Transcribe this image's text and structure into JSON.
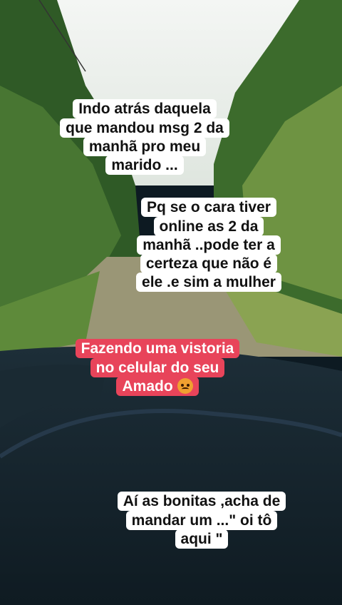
{
  "captions": {
    "cap1": "Indo atrás daquela\nque mandou msg 2 da\nmanhã pro meu\nmarido ...",
    "cap2": "Pq se o cara tiver\nonline as 2 da\nmanhã ..pode ter a\ncerteza que não é\nele .e sim a mulher",
    "cap3_main": "Fazendo uma vistoria\nno celular do seu\nAmado ",
    "cap4": "Aí as bonitas ,acha de\nmandar um ...\" oi tô\naqui \""
  },
  "emoji": "angry-face-icon",
  "colors": {
    "caption_white": "#ffffff",
    "caption_red": "#e8445a",
    "dashboard": "#14232c"
  }
}
